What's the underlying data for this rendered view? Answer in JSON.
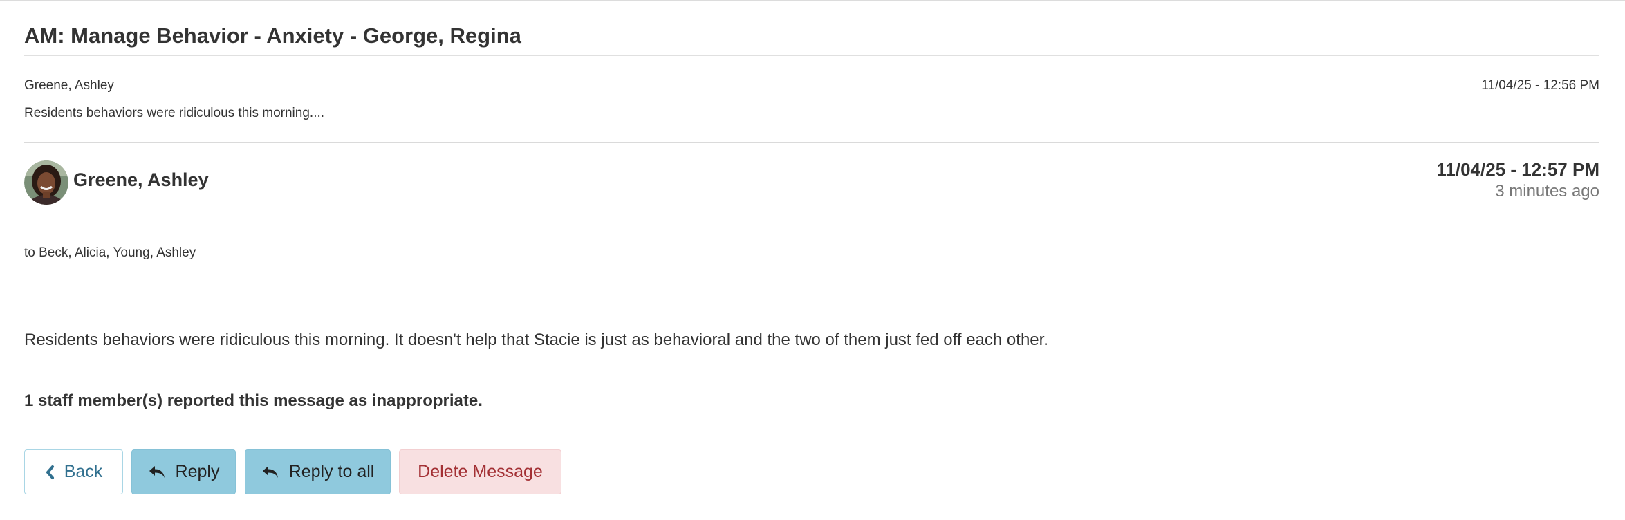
{
  "message": {
    "title": "AM: Manage Behavior - Anxiety - George, Regina",
    "preview": {
      "author": "Greene, Ashley",
      "timestamp": "11/04/25 - 12:56 PM",
      "snippet": "Residents behaviors were ridiculous this morning...."
    },
    "sender": {
      "name": "Greene, Ashley",
      "avatar_icon": "user-avatar"
    },
    "timestamp": "11/04/25 - 12:57 PM",
    "relative_time": "3 minutes ago",
    "recipients": "to Beck, Alicia, Young, Ashley",
    "body": "Residents behaviors were ridiculous this morning. It doesn't help that Stacie is just as behavioral and the two of them just fed off each other.",
    "report_notice": "1 staff member(s) reported this message as inappropriate."
  },
  "actions": {
    "back_label": "Back",
    "back_icon": "chevron-left-icon",
    "reply_label": "Reply",
    "reply_icon": "reply-icon",
    "reply_all_label": "Reply to all",
    "reply_all_icon": "reply-icon",
    "delete_label": "Delete Message"
  },
  "colors": {
    "info_button": "#8fc9dd",
    "back_text": "#31708f",
    "danger_bg": "#f8e0e1",
    "danger_text": "#a33034"
  }
}
